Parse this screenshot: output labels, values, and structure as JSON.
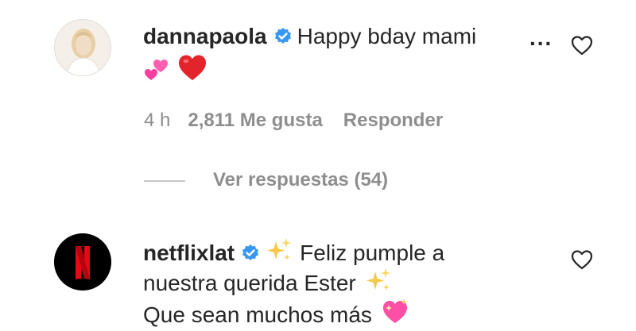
{
  "comments": [
    {
      "username": "dannapaola",
      "text_visible": "Happy bday mami",
      "more": "...",
      "time": "4 h",
      "likes": "2,811 Me gusta",
      "reply": "Responder",
      "emoji": [
        "two-hearts",
        "red-heart"
      ],
      "view_replies": "Ver respuestas (54)"
    },
    {
      "username": "netflixlat",
      "line1_text": "Feliz pumple a",
      "line2_text": "nuestra querida Ester",
      "line3_text": "Que sean muchos más",
      "emoji": [
        "sparkles",
        "sparkles",
        "sparkling-heart"
      ]
    }
  ],
  "colors": {
    "text": "#262626",
    "secondary": "#8e8e8e",
    "verified": "#3897f0",
    "netflix_red": "#e50914"
  }
}
